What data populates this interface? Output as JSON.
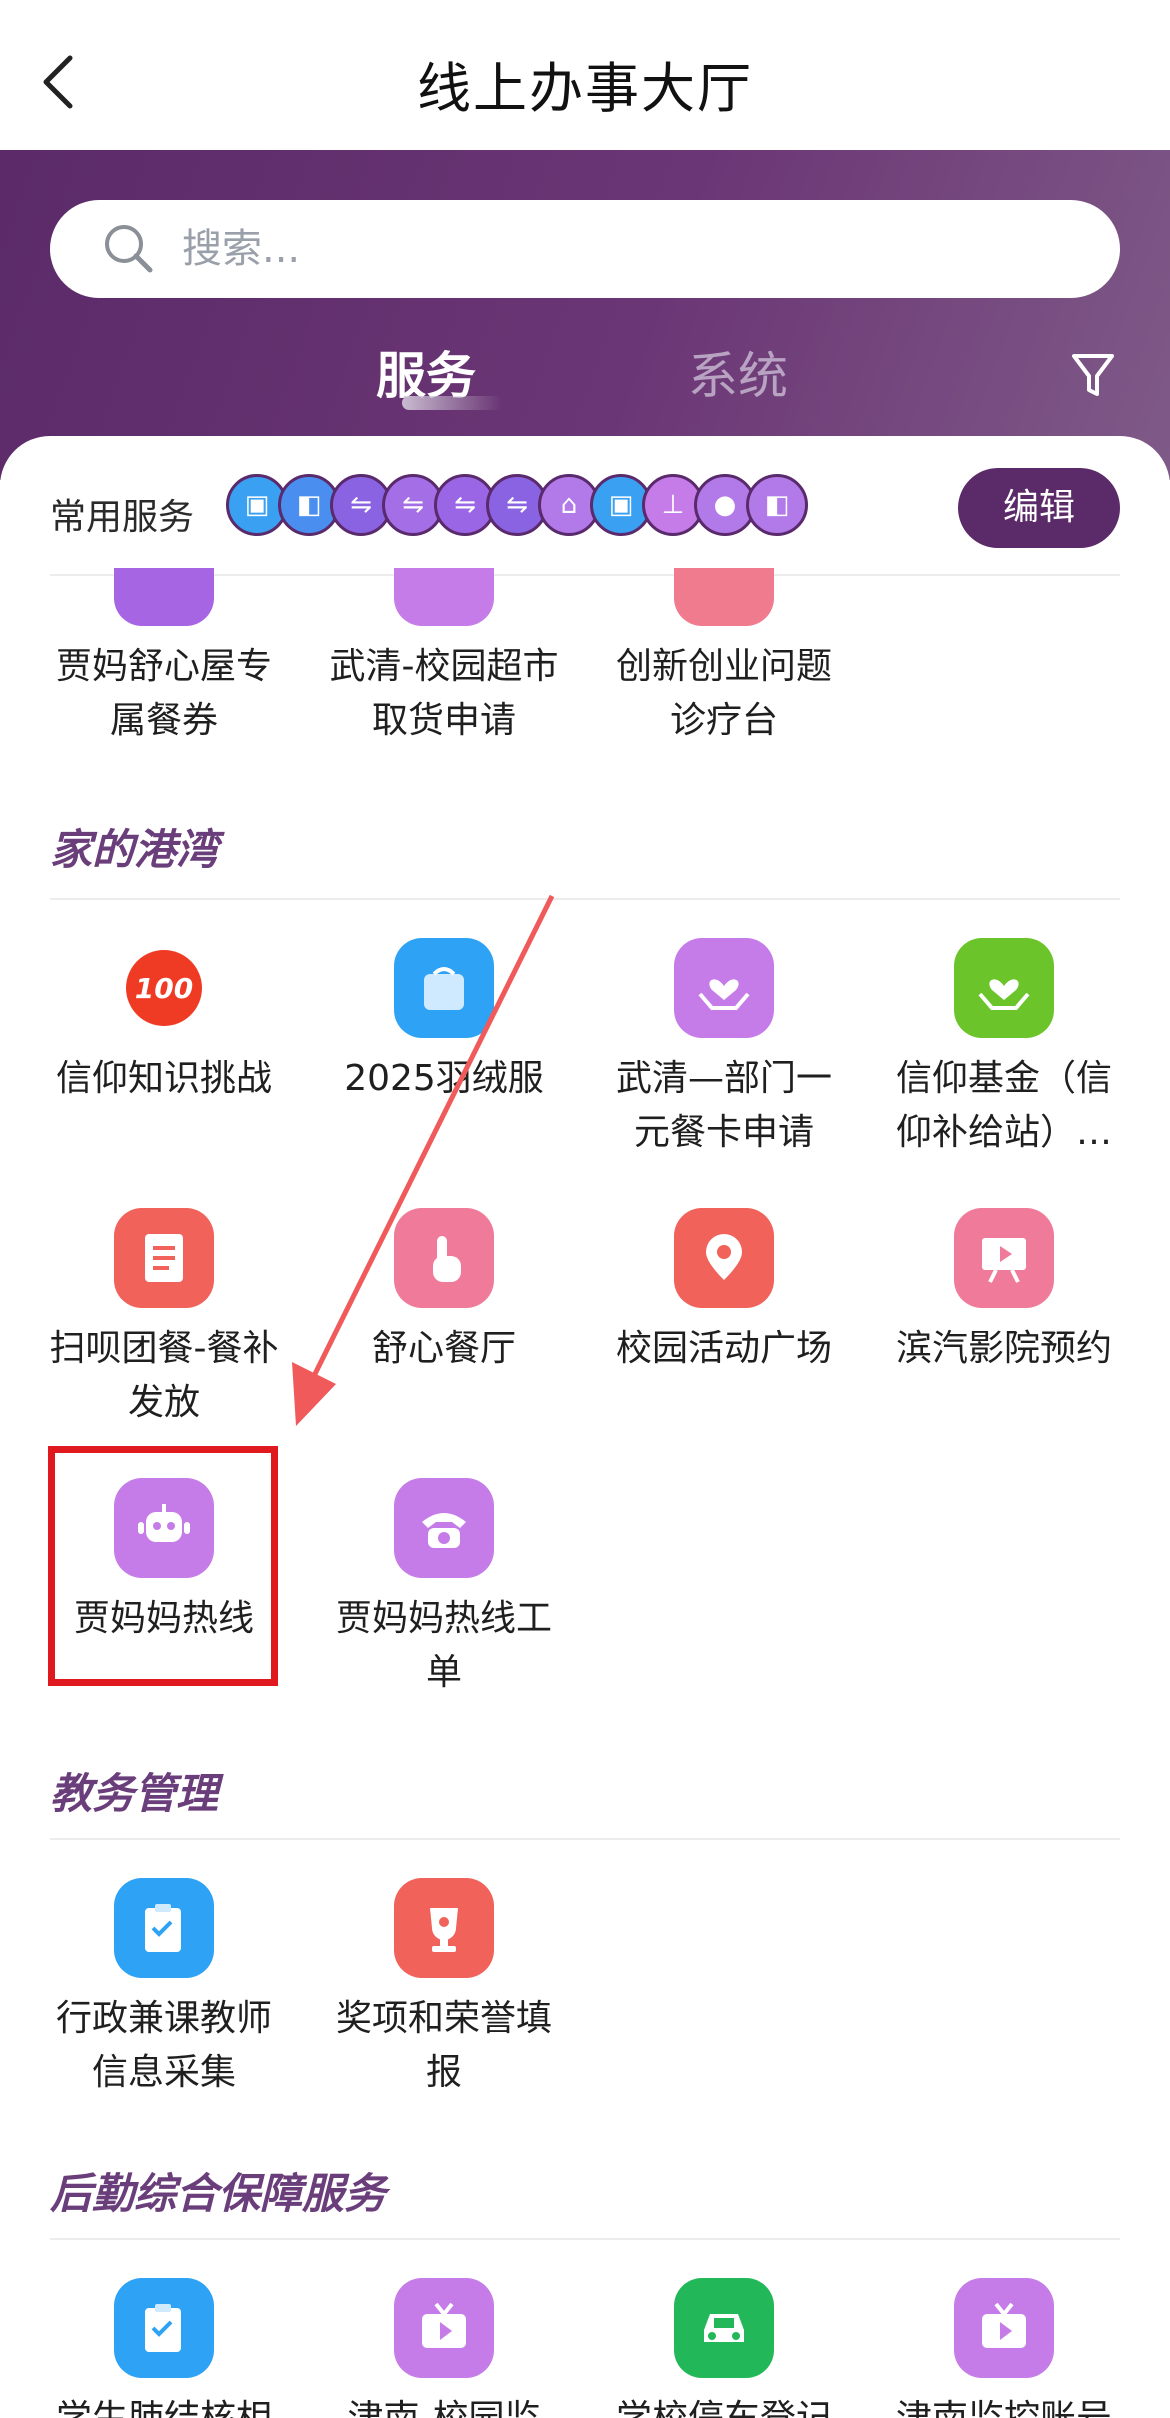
{
  "header": {
    "title": "线上办事大厅"
  },
  "search": {
    "placeholder": "搜索..."
  },
  "tabs": [
    {
      "label": "服务"
    },
    {
      "label": "系统"
    }
  ],
  "favorites": {
    "label": "常用服务",
    "icons": [
      "building-icon",
      "car-icon",
      "bus-icon",
      "bus-icon",
      "bus-icon",
      "bus-icon",
      "bank-icon",
      "building-icon",
      "stamp-icon",
      "person-icon",
      "car-icon"
    ],
    "edit_label": "编辑"
  },
  "partial_row": [
    {
      "label": "贾妈舒心屋专属餐券",
      "color": "#a665e3"
    },
    {
      "label": "武清-校园超市取货申请",
      "color": "#c57be8"
    },
    {
      "label": "创新创业问题诊疗台",
      "color": "#f07a8e"
    }
  ],
  "sections": {
    "home_harbor": {
      "title": "家的港湾",
      "items": [
        {
          "label": "信仰知识挑战",
          "icon": "100-badge-icon",
          "color": "#ef3b24"
        },
        {
          "label": "2025羽绒服",
          "icon": "shopping-bag-icon",
          "color": "#2ea2f4"
        },
        {
          "label": "武清—部门一元餐卡申请",
          "icon": "heart-hands-icon",
          "color": "#c57be8"
        },
        {
          "label": "信仰基金（信仰补给站）…",
          "icon": "heart-hands-icon",
          "color": "#6bc42a"
        },
        {
          "label": "扫呗团餐-餐补发放",
          "icon": "receipt-icon",
          "color": "#f0625a"
        },
        {
          "label": "舒心餐厅",
          "icon": "tap-hand-icon",
          "color": "#f07a9a"
        },
        {
          "label": "校园活动广场",
          "icon": "location-pin-icon",
          "color": "#f0625a"
        },
        {
          "label": "滨汽影院预约",
          "icon": "presentation-icon",
          "color": "#f07a9a"
        },
        {
          "label": "贾妈妈热线",
          "icon": "robot-icon",
          "color": "#c57be8"
        },
        {
          "label": "贾妈妈热线工单",
          "icon": "telephone-icon",
          "color": "#c57be8"
        }
      ]
    },
    "academic": {
      "title": "教务管理",
      "items": [
        {
          "label": "行政兼课教师信息采集",
          "icon": "clipboard-icon",
          "color": "#2ea2f4"
        },
        {
          "label": "奖项和荣誉填报",
          "icon": "trophy-icon",
          "color": "#f0625a"
        }
      ]
    },
    "logistics": {
      "title": "后勤综合保障服务",
      "items": [
        {
          "label": "学生肺结核相",
          "icon": "clipboard-icon",
          "color": "#2ea2f4"
        },
        {
          "label": "津南-校园监",
          "icon": "tv-icon",
          "color": "#c57be8"
        },
        {
          "label": "学校停车登记",
          "icon": "car-icon",
          "color": "#22b85a"
        },
        {
          "label": "津南监控账号",
          "icon": "tv-icon",
          "color": "#c57be8"
        }
      ]
    }
  }
}
